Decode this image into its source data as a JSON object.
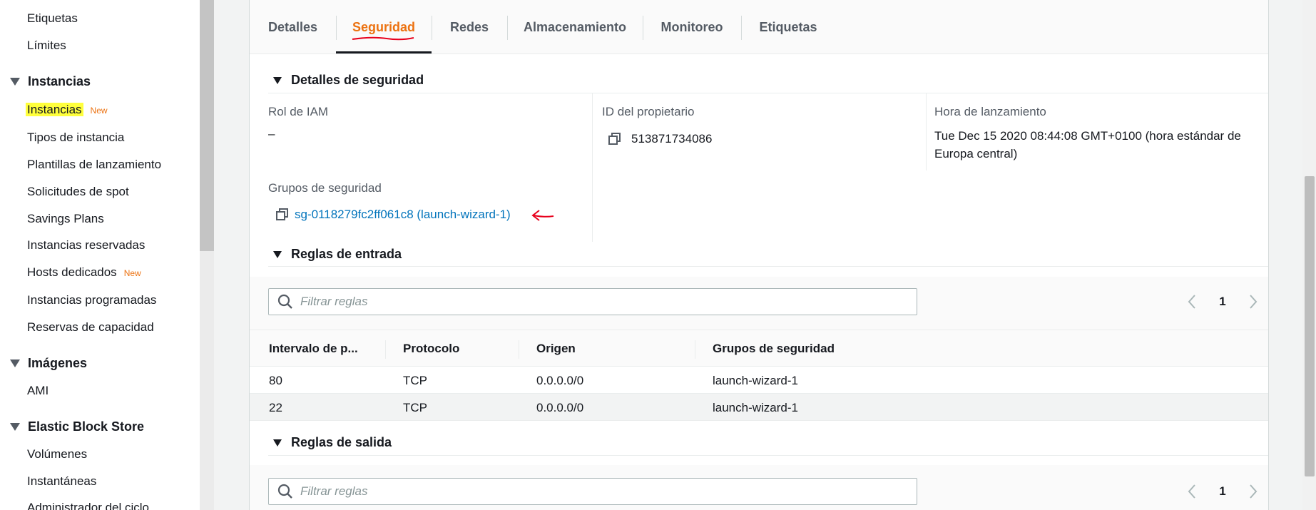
{
  "sidebar": {
    "items_top": [
      "Etiquetas",
      "Límites"
    ],
    "group_instances": "Instancias",
    "instances_items": [
      {
        "label": "Instancias",
        "badge": "New"
      },
      {
        "label": "Tipos de instancia"
      },
      {
        "label": "Plantillas de lanzamiento"
      },
      {
        "label": "Solicitudes de spot"
      },
      {
        "label": "Savings Plans"
      },
      {
        "label": "Instancias reservadas"
      },
      {
        "label": "Hosts dedicados",
        "badge": "New"
      },
      {
        "label": "Instancias programadas"
      },
      {
        "label": "Reservas de capacidad"
      }
    ],
    "group_images": "Imágenes",
    "images_items": [
      "AMI"
    ],
    "group_ebs": "Elastic Block Store",
    "ebs_items": [
      "Volúmenes",
      "Instantáneas",
      "Administrador del ciclo"
    ]
  },
  "tabs": [
    "Detalles",
    "Seguridad",
    "Redes",
    "Almacenamiento",
    "Monitoreo",
    "Etiquetas"
  ],
  "active_tab": "Seguridad",
  "security": {
    "heading": "Detalles de seguridad",
    "iam_label": "Rol de IAM",
    "iam_value": "–",
    "owner_label": "ID del propietario",
    "owner_value": "513871734086",
    "launch_label": "Hora de lanzamiento",
    "launch_value": "Tue Dec 15 2020 08:44:08 GMT+0100 (hora estándar de Europa central)",
    "groups_label": "Grupos de seguridad",
    "groups_value": "sg-0118279fc2ff061c8 (launch-wizard-1)"
  },
  "inbound": {
    "heading": "Reglas de entrada",
    "filter_placeholder": "Filtrar reglas",
    "page": "1",
    "columns": [
      "Intervalo de p...",
      "Protocolo",
      "Origen",
      "Grupos de seguridad"
    ],
    "rows": [
      [
        "80",
        "TCP",
        "0.0.0.0/0",
        "launch-wizard-1"
      ],
      [
        "22",
        "TCP",
        "0.0.0.0/0",
        "launch-wizard-1"
      ]
    ]
  },
  "outbound": {
    "heading": "Reglas de salida",
    "filter_placeholder": "Filtrar reglas",
    "page": "1"
  },
  "colors": {
    "accent": "#ec7211",
    "link": "#0073bb",
    "annotation": "#e8001c",
    "highlight": "#ffff3c"
  }
}
